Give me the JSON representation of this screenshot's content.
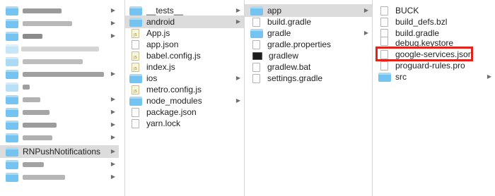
{
  "column1": {
    "selected_item": "RNPushNotifications"
  },
  "column2": {
    "items": [
      {
        "label": "__tests__",
        "icon": "folder-icon"
      },
      {
        "label": "android",
        "icon": "folder-icon"
      },
      {
        "label": "App.js",
        "icon": "js-file-icon"
      },
      {
        "label": "app.json",
        "icon": "file-icon"
      },
      {
        "label": "babel.config.js",
        "icon": "js-file-icon"
      },
      {
        "label": "index.js",
        "icon": "js-file-icon"
      },
      {
        "label": "ios",
        "icon": "folder-icon"
      },
      {
        "label": "metro.config.js",
        "icon": "js-file-icon"
      },
      {
        "label": "node_modules",
        "icon": "folder-icon"
      },
      {
        "label": "package.json",
        "icon": "file-icon"
      },
      {
        "label": "yarn.lock",
        "icon": "file-icon"
      }
    ]
  },
  "column3": {
    "items": [
      {
        "label": "app",
        "icon": "folder-icon"
      },
      {
        "label": "build.gradle",
        "icon": "file-icon"
      },
      {
        "label": "gradle",
        "icon": "folder-icon"
      },
      {
        "label": "gradle.properties",
        "icon": "file-icon"
      },
      {
        "label": "gradlew",
        "icon": "terminal-icon"
      },
      {
        "label": "gradlew.bat",
        "icon": "file-icon"
      },
      {
        "label": "settings.gradle",
        "icon": "file-icon"
      }
    ]
  },
  "column4": {
    "items": [
      {
        "label": "BUCK",
        "icon": "file-icon"
      },
      {
        "label": "build_defs.bzl",
        "icon": "file-icon"
      },
      {
        "label": "build.gradle",
        "icon": "file-icon"
      },
      {
        "label": "debug.keystore",
        "icon": "file-icon"
      },
      {
        "label": "google-services.json",
        "icon": "file-icon"
      },
      {
        "label": "proguard-rules.pro",
        "icon": "file-icon"
      },
      {
        "label": "src",
        "icon": "folder-icon"
      }
    ]
  },
  "chevron_glyph": "▶"
}
